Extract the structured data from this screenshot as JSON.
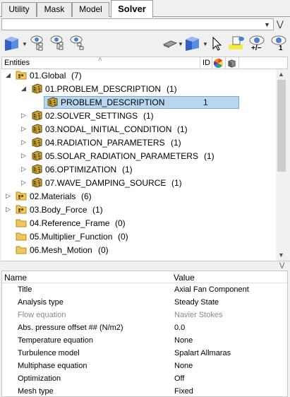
{
  "tabs": [
    {
      "label": "Utility",
      "active": false
    },
    {
      "label": "Mask",
      "active": false
    },
    {
      "label": "Model",
      "active": false
    },
    {
      "label": "Solver",
      "active": true
    }
  ],
  "search": {
    "value": "",
    "placeholder": ""
  },
  "toolbar": {
    "icons": [
      "component-view-icon",
      "filter-eye-icon",
      "filter-eye-tree-icon",
      "filter-eye-list-icon",
      "eraser-icon",
      "entity-cube-icon",
      "cursor-icon",
      "highlight-icon",
      "show-all-icon",
      "isolate-icon"
    ],
    "show_label": "+/−",
    "isolate_label": "1"
  },
  "entities_header": {
    "label": "Entities",
    "id_label": "ID"
  },
  "tree": [
    {
      "indent": 0,
      "expander": "◢",
      "icon": "folder-group-icon",
      "label": "01.Global",
      "count": "(7)"
    },
    {
      "indent": 1,
      "expander": "◢",
      "icon": "cube-group-icon",
      "label": "01.PROBLEM_DESCRIPTION",
      "count": "(1)"
    },
    {
      "indent": 2,
      "expander": "",
      "icon": "cube-item-icon",
      "label": "PROBLEM_DESCRIPTION",
      "count": "",
      "id": "1",
      "selected": true
    },
    {
      "indent": 1,
      "expander": "▷",
      "icon": "cube-group-icon",
      "label": "02.SOLVER_SETTINGS",
      "count": "(1)"
    },
    {
      "indent": 1,
      "expander": "▷",
      "icon": "cube-group-icon",
      "label": "03.NODAL_INITIAL_CONDITION",
      "count": "(1)"
    },
    {
      "indent": 1,
      "expander": "▷",
      "icon": "cube-group-icon",
      "label": "04.RADIATION_PARAMETERS",
      "count": "(1)"
    },
    {
      "indent": 1,
      "expander": "▷",
      "icon": "cube-group-icon",
      "label": "05.SOLAR_RADIATION_PARAMETERS",
      "count": "(1)"
    },
    {
      "indent": 1,
      "expander": "▷",
      "icon": "cube-group-icon",
      "label": "06.OPTIMIZATION",
      "count": "(1)"
    },
    {
      "indent": 1,
      "expander": "▷",
      "icon": "cube-group-icon",
      "label": "07.WAVE_DAMPING_SOURCE",
      "count": "(1)"
    },
    {
      "indent": 0,
      "expander": "▷",
      "icon": "folder-group-icon",
      "label": "02.Materials",
      "count": "(6)"
    },
    {
      "indent": 0,
      "expander": "▷",
      "icon": "folder-group-icon",
      "label": "03.Body_Force",
      "count": "(1)"
    },
    {
      "indent": 0,
      "expander": "",
      "icon": "folder-empty-icon",
      "label": "04.Reference_Frame",
      "count": "(0)"
    },
    {
      "indent": 0,
      "expander": "",
      "icon": "folder-empty-icon",
      "label": "05.Multiplier_Function",
      "count": "(0)"
    },
    {
      "indent": 0,
      "expander": "",
      "icon": "folder-empty-icon",
      "label": "06.Mesh_Motion",
      "count": "(0)"
    }
  ],
  "properties": {
    "name_header": "Name",
    "value_header": "Value",
    "rows": [
      {
        "name": "Title",
        "value": "Axial Fan Component",
        "disabled": false
      },
      {
        "name": "Analysis type",
        "value": "Steady State",
        "disabled": false
      },
      {
        "name": "Flow equation",
        "value": "Navier Stokes",
        "disabled": true
      },
      {
        "name": "Abs. pressure offset ## (N/m2)",
        "value": "0.0",
        "disabled": false
      },
      {
        "name": "Temperature equation",
        "value": "None",
        "disabled": false
      },
      {
        "name": "Turbulence model",
        "value": "Spalart Allmaras",
        "disabled": false
      },
      {
        "name": "Multiphase equation",
        "value": "None",
        "disabled": false
      },
      {
        "name": "Optimization",
        "value": "Off",
        "disabled": false
      },
      {
        "name": "Mesh type",
        "value": "Fixed",
        "disabled": false
      }
    ]
  },
  "colors": {
    "selection": "#b8d6ee",
    "folder": "#e8b84a",
    "accent": "#2f6fc9"
  }
}
